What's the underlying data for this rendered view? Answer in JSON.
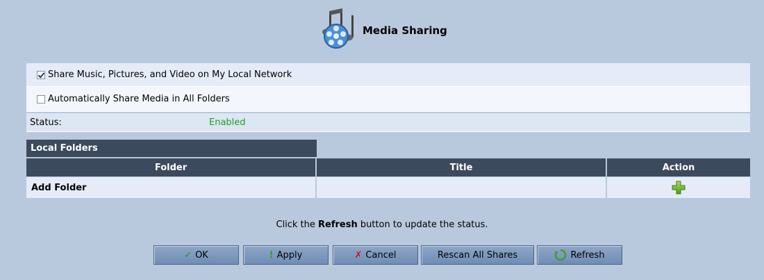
{
  "header": {
    "title": "Media Sharing",
    "icon": "media-sharing-icon"
  },
  "options": {
    "share_label": "Share Music, Pictures, and Video on My Local Network",
    "share_checked": true,
    "auto_label": "Automatically Share Media in All Folders",
    "auto_checked": false
  },
  "status": {
    "label": "Status:",
    "value": "Enabled",
    "value_color": "#21a020"
  },
  "table": {
    "caption": "Local Folders",
    "columns": [
      "Folder",
      "Title",
      "Action"
    ],
    "rows": [
      {
        "folder": "Add Folder",
        "title": "",
        "action_icon": "add-icon"
      }
    ]
  },
  "message": {
    "prefix": "Click the ",
    "bold": "Refresh",
    "suffix": " button to update the status."
  },
  "buttons": {
    "ok": "OK",
    "apply": "Apply",
    "cancel": "Cancel",
    "rescan": "Rescan All Shares",
    "refresh": "Refresh"
  },
  "colors": {
    "background": "#b9c9dd",
    "table_header": "#3b4a5c",
    "status_enabled": "#21a020"
  }
}
